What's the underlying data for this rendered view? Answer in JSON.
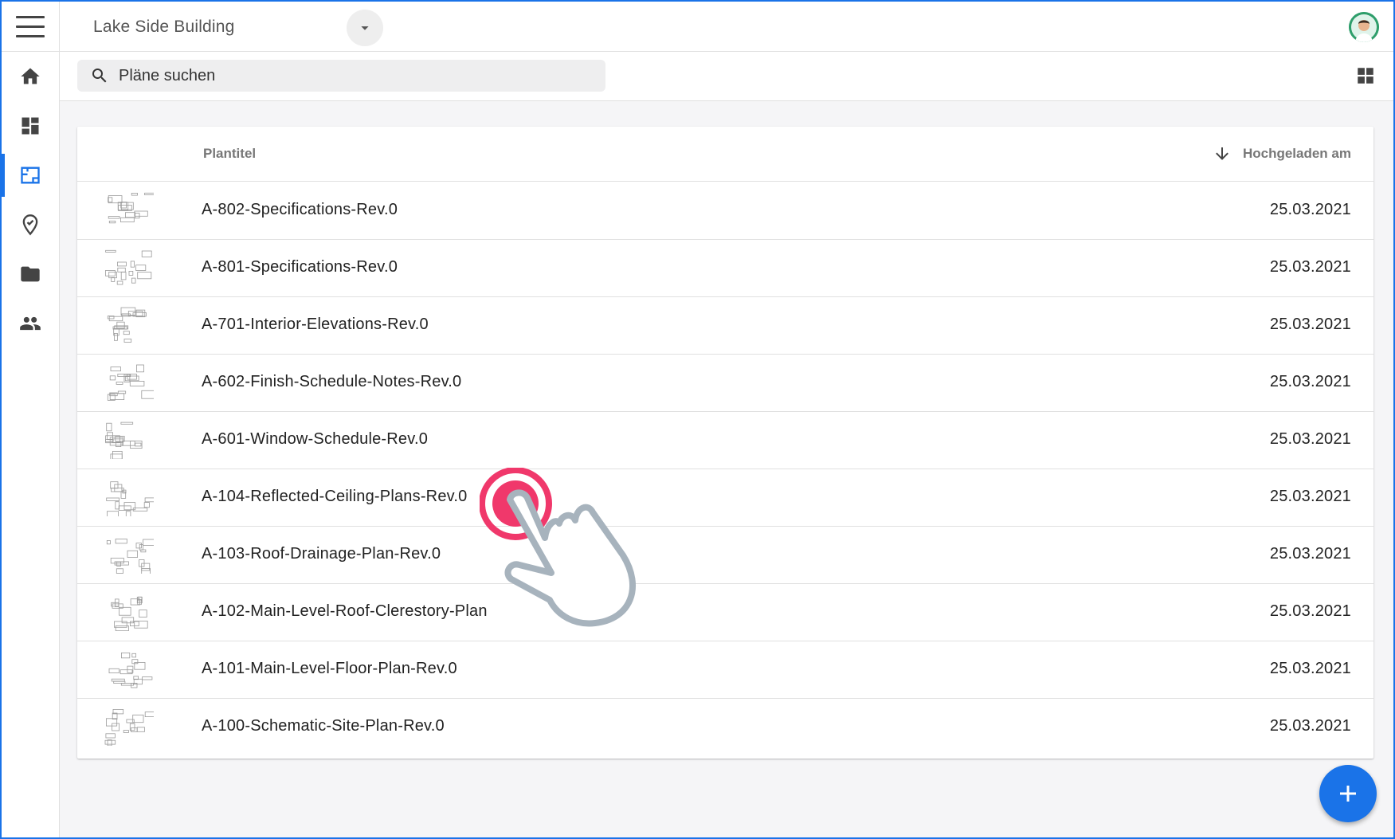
{
  "topbar": {
    "project_title": "Lake Side Building"
  },
  "search": {
    "placeholder": "Pläne suchen"
  },
  "table": {
    "columns": {
      "title": "Plantitel",
      "uploaded": "Hochgeladen am"
    },
    "rows": [
      {
        "title": "A-802-Specifications-Rev.0",
        "date": "25.03.2021"
      },
      {
        "title": "A-801-Specifications-Rev.0",
        "date": "25.03.2021"
      },
      {
        "title": "A-701-Interior-Elevations-Rev.0",
        "date": "25.03.2021"
      },
      {
        "title": "A-602-Finish-Schedule-Notes-Rev.0",
        "date": "25.03.2021"
      },
      {
        "title": "A-601-Window-Schedule-Rev.0",
        "date": "25.03.2021"
      },
      {
        "title": "A-104-Reflected-Ceiling-Plans-Rev.0",
        "date": "25.03.2021"
      },
      {
        "title": "A-103-Roof-Drainage-Plan-Rev.0",
        "date": "25.03.2021"
      },
      {
        "title": "A-102-Main-Level-Roof-Clerestory-Plan",
        "date": "25.03.2021"
      },
      {
        "title": "A-101-Main-Level-Floor-Plan-Rev.0",
        "date": "25.03.2021"
      },
      {
        "title": "A-100-Schematic-Site-Plan-Rev.0",
        "date": "25.03.2021"
      }
    ]
  },
  "colors": {
    "accent": "#1a73e8",
    "tap": "#f0386b"
  },
  "icons": {
    "menu": "menu-icon",
    "home": "home-icon",
    "dashboard": "dashboard-icon",
    "plans": "plans-icon",
    "location": "location-check-icon",
    "folder": "folder-icon",
    "people": "people-icon",
    "search": "search-icon",
    "grid": "grid-view-icon",
    "add": "plus-icon"
  }
}
